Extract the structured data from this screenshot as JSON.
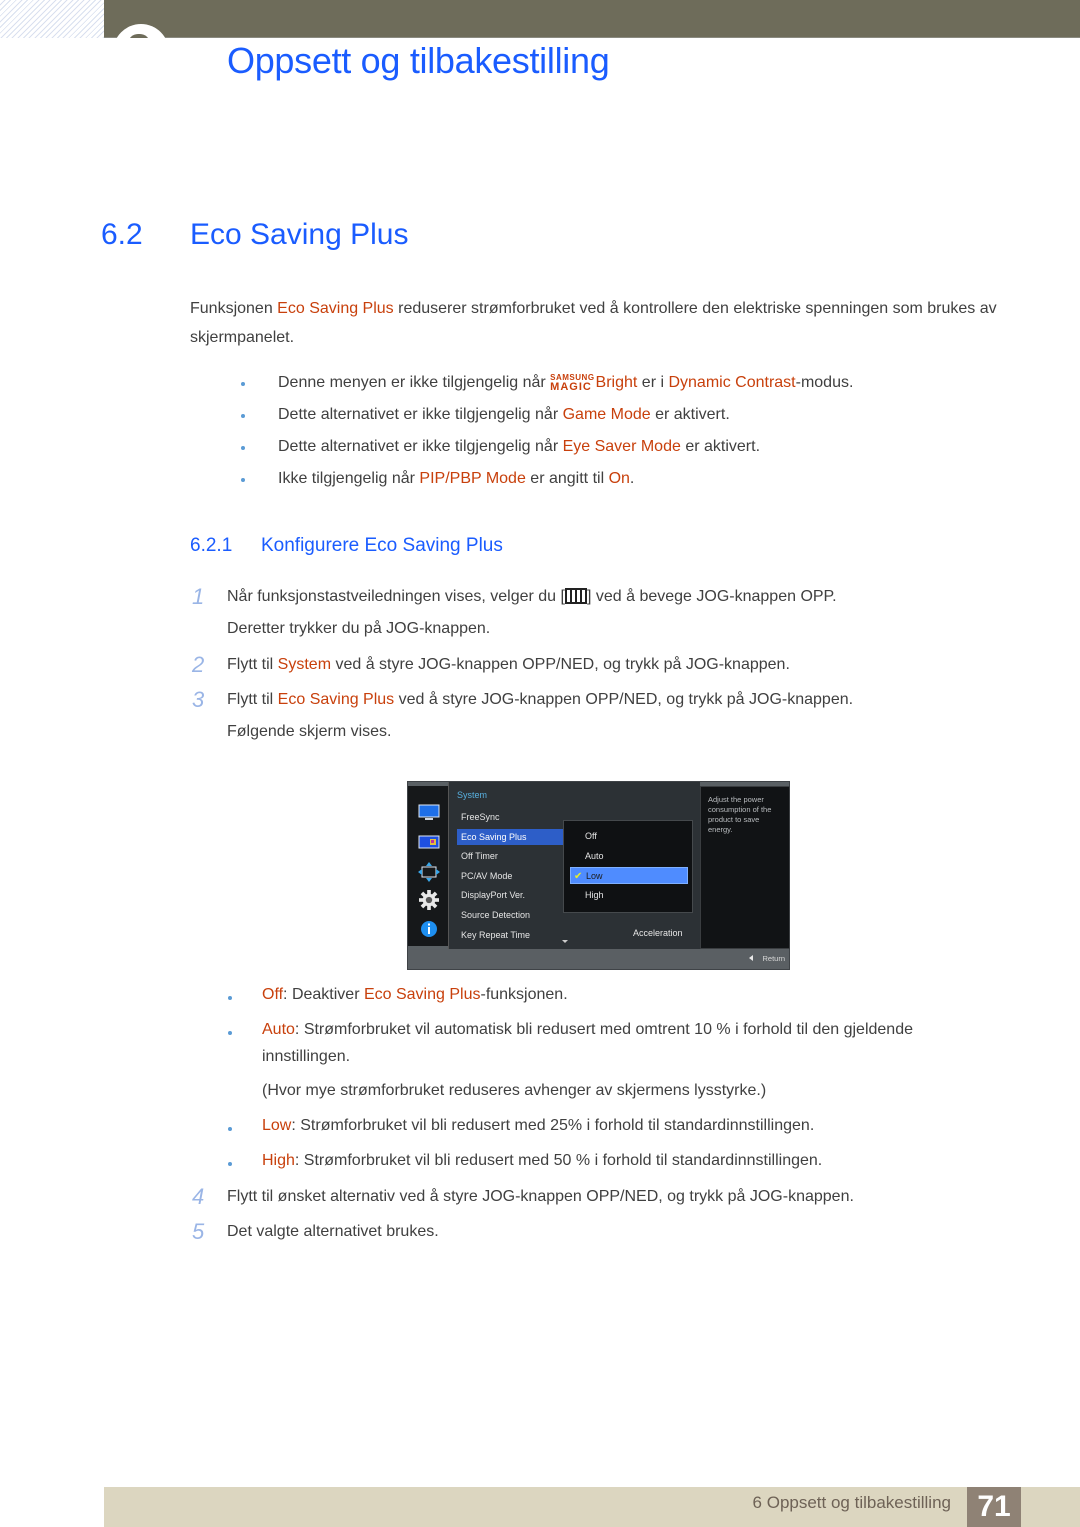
{
  "header": {
    "chapter_title": "Oppsett og tilbakestilling"
  },
  "section": {
    "number": "6.2",
    "title": "Eco Saving Plus"
  },
  "intro": {
    "pre": "Funksjonen ",
    "highlight": "Eco Saving Plus",
    "post": " reduserer strømforbruket ved å kontrollere den elektriske spenningen som brukes av skjermpanelet."
  },
  "notes": [
    {
      "pre": "Denne menyen er ikke tilgjengelig når ",
      "brand_top": "SAMSUNG",
      "brand_bottom": "MAGIC",
      "hl1": "Bright",
      "mid": " er i ",
      "hl2": "Dynamic Contrast",
      "post": "-modus."
    },
    {
      "pre": "Dette alternativet er ikke tilgjengelig når ",
      "hl1": "Game Mode",
      "post": " er aktivert."
    },
    {
      "pre": "Dette alternativet er ikke tilgjengelig når ",
      "hl1": "Eye Saver Mode",
      "post": " er aktivert."
    },
    {
      "pre": "Ikke tilgjengelig når ",
      "hl1": "PIP/PBP Mode",
      "mid": " er angitt til ",
      "hl2": "On",
      "post": "."
    }
  ],
  "subsection": {
    "number": "6.2.1",
    "title": "Konfigurere Eco Saving Plus"
  },
  "steps": [
    {
      "num": "1",
      "pre": "Når funksjonstastveiledningen vises, velger du [",
      "icon": "menu-icon",
      "post": "] ved å bevege JOG-knappen OPP.",
      "cont": "Deretter trykker du på JOG-knappen."
    },
    {
      "num": "2",
      "pre": "Flytt til ",
      "hl": "System",
      "post": " ved å styre JOG-knappen OPP/NED, og trykk på JOG-knappen."
    },
    {
      "num": "3",
      "pre": "Flytt til ",
      "hl": "Eco Saving Plus",
      "post": " ved å styre JOG-knappen OPP/NED, og trykk på JOG-knappen.",
      "cont": "Følgende skjerm vises."
    },
    {
      "num": "4",
      "text": "Flytt til ønsket alternativ ved å styre JOG-knappen OPP/NED, og trykk på JOG-knappen."
    },
    {
      "num": "5",
      "text": "Det valgte alternativet brukes."
    }
  ],
  "osd": {
    "menu_title": "System",
    "items": [
      "FreeSync",
      "Eco Saving Plus",
      "Off Timer",
      "PC/AV Mode",
      "DisplayPort Ver.",
      "Source Detection",
      "Key Repeat Time"
    ],
    "selected_item": "Eco Saving Plus",
    "options": [
      "Off",
      "Auto",
      "Low",
      "High"
    ],
    "selected_option": "Low",
    "extra_value": "Acceleration",
    "help_text": "Adjust the power consumption of the product to save energy.",
    "return_label": "Return",
    "left_icons": [
      "picture-icon",
      "color-icon",
      "size-position-icon",
      "gear-icon",
      "info-icon"
    ],
    "colors": {
      "highlight": "#2d5ec8",
      "option_highlight": "#4f8cff",
      "title": "#58b1e0",
      "check": "#e7ef2c"
    }
  },
  "options_desc": [
    {
      "hl": "Off",
      "sep": ": Deaktiver ",
      "hl2": "Eco Saving Plus",
      "post": "-funksjonen."
    },
    {
      "hl": "Auto",
      "post": ": Strømforbruket vil automatisk bli redusert med omtrent 10 % i forhold til den gjeldende",
      "cont": "innstillingen.",
      "note": "(Hvor mye strømforbruket reduseres avhenger av skjermens lysstyrke.)"
    },
    {
      "hl": "Low",
      "post": ": Strømforbruket vil bli redusert med 25% i forhold til standardinnstillingen."
    },
    {
      "hl": "High",
      "post": ": Strømforbruket vil bli redusert med 50 % i forhold til standardinnstillingen."
    }
  ],
  "footer": {
    "chapter_label": "6 Oppsett og tilbakestilling",
    "page_number": "71"
  },
  "colors": {
    "heading_blue": "#1a5cff",
    "highlight_orange": "#c8400c",
    "header_bar": "#6e6c5a",
    "footer_bar": "#dcd6c0",
    "page_box": "#8f8275"
  }
}
